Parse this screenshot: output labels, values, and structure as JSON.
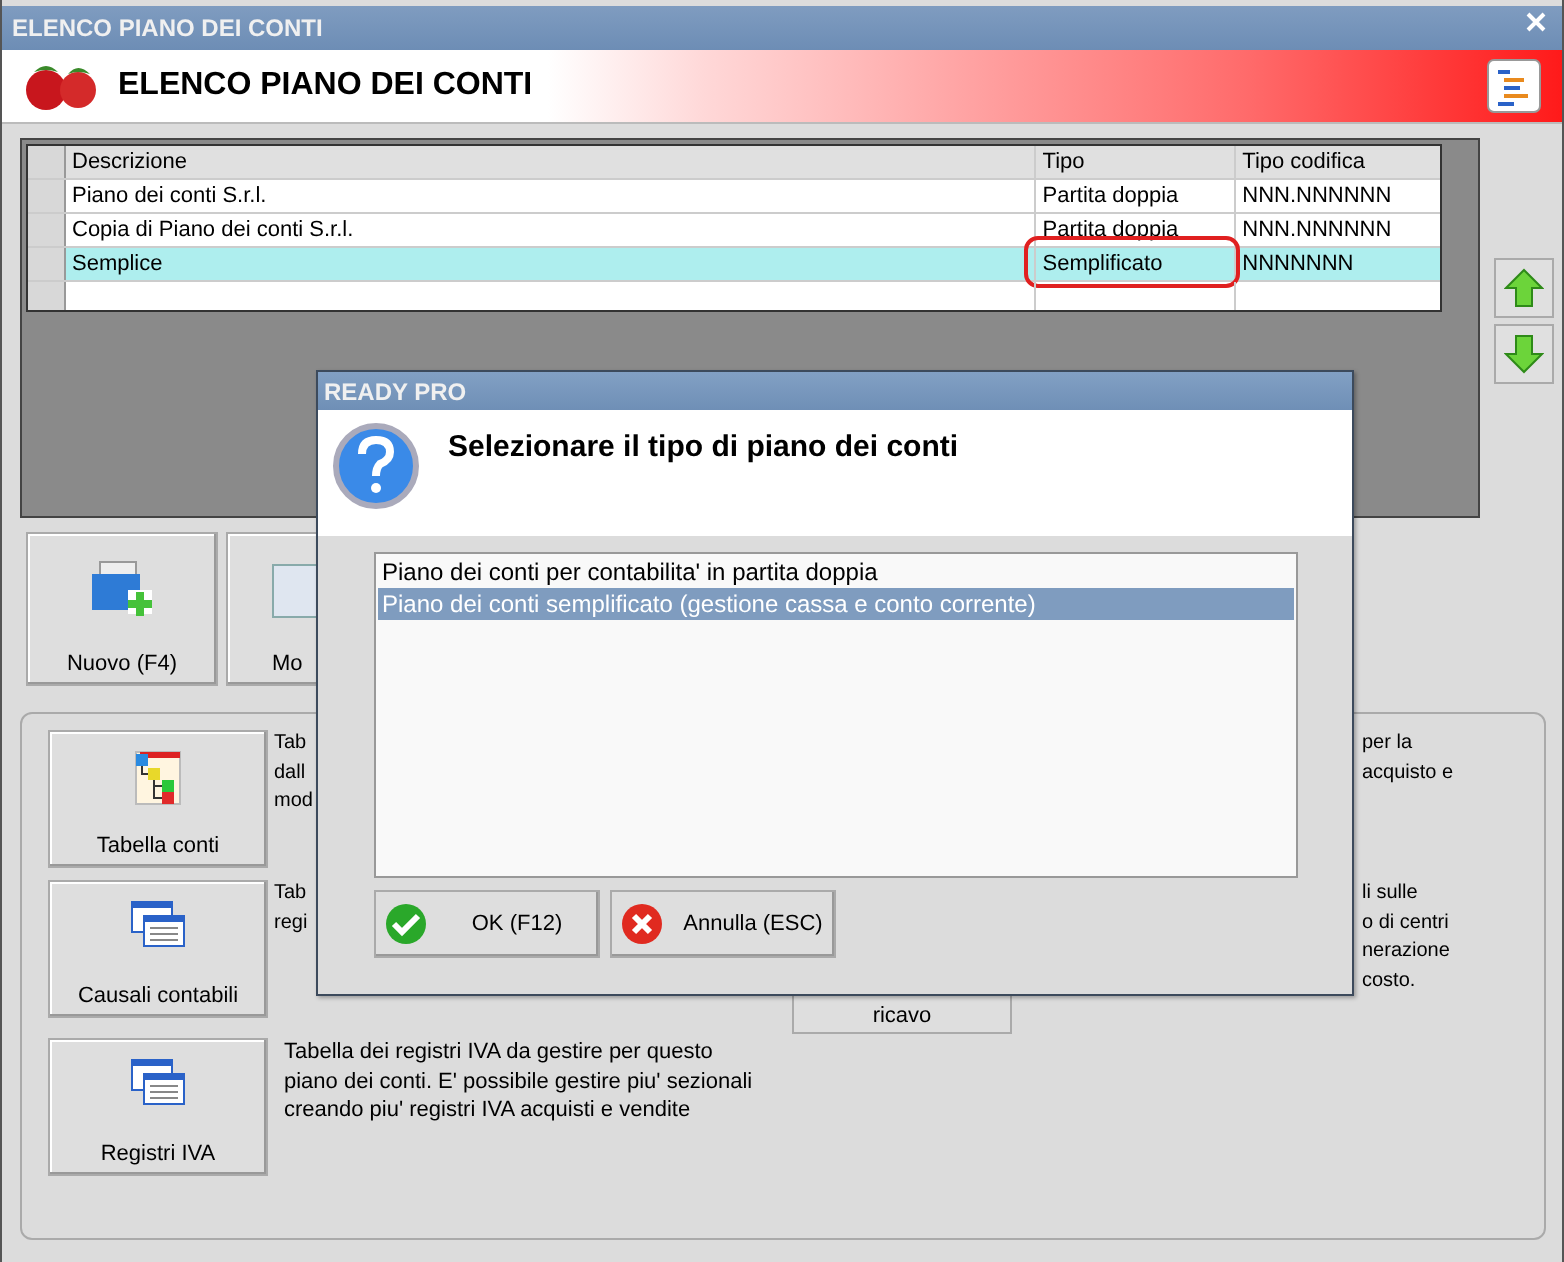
{
  "window": {
    "title": "ELENCO PIANO DEI CONTI"
  },
  "header": {
    "title": "ELENCO PIANO DEI CONTI"
  },
  "table": {
    "columns": [
      "Descrizione",
      "Tipo",
      "Tipo codifica"
    ],
    "rows": [
      {
        "cells": [
          "Piano dei conti S.r.l.",
          "Partita doppia",
          "NNN.NNNNNN"
        ],
        "selected": false,
        "circled": false
      },
      {
        "cells": [
          "Copia di Piano dei conti S.r.l.",
          "Partita doppia",
          "NNN.NNNNNN"
        ],
        "selected": false,
        "circled": false
      },
      {
        "cells": [
          "Semplice",
          "Semplificato",
          "NNNNNNN"
        ],
        "selected": true,
        "circled": true
      }
    ]
  },
  "actions": [
    {
      "label": "Nuovo (F4)",
      "kind": "new"
    },
    {
      "label": "Mo",
      "kind": "edit"
    }
  ],
  "sections": [
    {
      "label": "Tabella conti",
      "kind": "tree",
      "text_left": [
        "Tab",
        "dall",
        "mod"
      ],
      "text_right": [
        "per la",
        "acquisto e"
      ]
    },
    {
      "label": "Causali contabili",
      "kind": "windows",
      "text_left": [
        "Tab",
        "regi"
      ],
      "text_right": [
        "li sulle",
        "o di centri",
        "nerazione",
        "costo."
      ],
      "extra_button": "ricavo"
    },
    {
      "label": "Registri IVA",
      "kind": "windows",
      "text": "Tabella dei registri IVA da gestire per questo piano dei conti. E' possibile gestire piu' sezionali creando piu' registri IVA acquisti e vendite"
    }
  ],
  "dialog": {
    "title": "READY PRO",
    "message": "Selezionare il tipo di piano dei conti",
    "options": [
      {
        "label": "Piano dei conti per contabilita' in partita doppia",
        "selected": false
      },
      {
        "label": "Piano dei conti semplificato (gestione cassa e conto corrente)",
        "selected": true
      }
    ],
    "buttons": [
      {
        "label": "OK (F12)",
        "kind": "ok"
      },
      {
        "label": "Annulla (ESC)",
        "kind": "cancel"
      }
    ]
  }
}
